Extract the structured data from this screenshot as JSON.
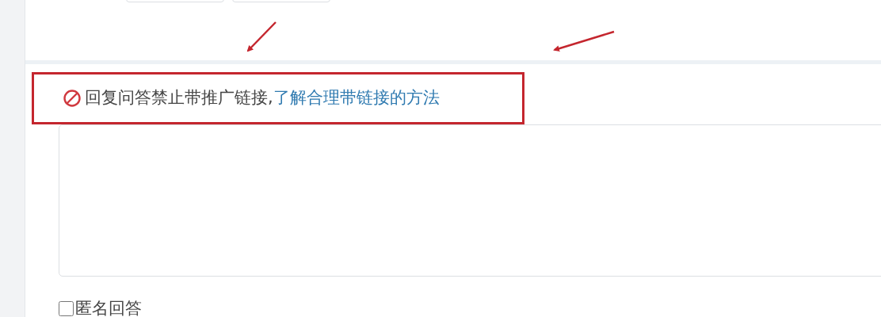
{
  "notice": {
    "text": "回复问答禁止带推广链接,",
    "link": "了解合理带链接的方法"
  },
  "anonymous": {
    "label": "匿名回答",
    "checked": false
  }
}
